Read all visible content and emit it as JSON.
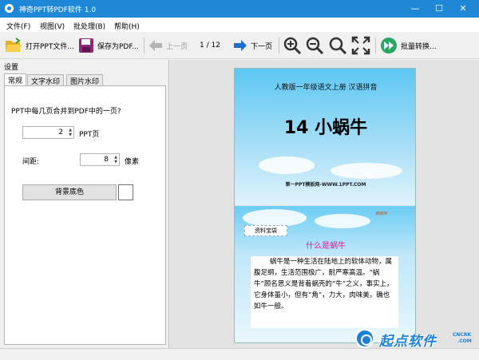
{
  "window": {
    "title": "神奇PPT转PDF软件 1.0",
    "minimize": "—",
    "maximize": "☐",
    "close": "✕"
  },
  "menu": [
    "文件(F)",
    "视图(V)",
    "批处理(B)",
    "帮助(H)"
  ],
  "toolbar": {
    "open": "打开PPT文件...",
    "save": "保存为PDF...",
    "prev": "上一页",
    "page_indicator": "1 / 12",
    "next": "下一页",
    "batch": "批量转换..."
  },
  "panel": {
    "title": "设置",
    "tabs": [
      "常规",
      "文字水印",
      "图片水印"
    ],
    "merge_question": "PPT中每几页合并到PDF中的一页?",
    "pages_value": "2",
    "pages_unit": "PPT页",
    "spacing_label": "间距:",
    "spacing_value": "8",
    "spacing_unit": "像素",
    "bg_button": "背景底色"
  },
  "document": {
    "slide1": {
      "subtitle": "人教版一年级语文上册   汉语拼音",
      "title": "14 小蜗牛",
      "site": "第一PPT模板网-WWW.1PPT.COM"
    },
    "slide2": {
      "tag": "模板网",
      "box": "资料宝袋",
      "heading": "什么是蜗牛",
      "body": "蜗牛是一种生活在陆地上的软体动物，属腹足纲，生活范围极广，耐严寒高温。“蜗牛”顾名思义是背着蜗壳的“牛”之义，事实上，它身体虽小，但有“角”，力大，肉味美，确也如牛一般。"
    }
  },
  "watermark": {
    "text": "起点软件",
    "sub1": "CNCRK",
    "sub2": ".COM"
  },
  "colors": {
    "titlebar": "#1e88d6",
    "accent": "#e0149a"
  }
}
